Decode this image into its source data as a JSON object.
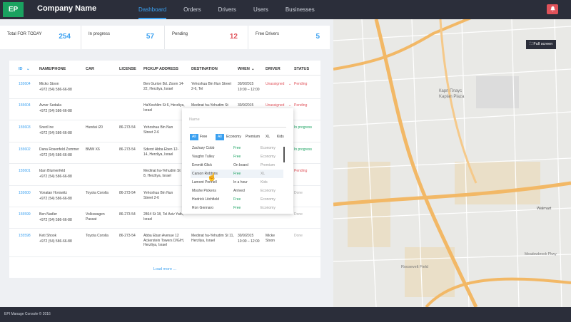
{
  "header": {
    "logo": "EP",
    "company": "Company Name",
    "nav": [
      "Dashboard",
      "Orders",
      "Drivers",
      "Users",
      "Businesses"
    ],
    "notification_icon": "bell-icon"
  },
  "stats": [
    {
      "label": "Total FOR TODAY",
      "value": "254",
      "color": "#3aa0f0"
    },
    {
      "label": "In progress",
      "value": "57",
      "color": "#3aa0f0"
    },
    {
      "label": "Pending",
      "value": "12",
      "color": "#e0525a"
    },
    {
      "label": "Free Drivers",
      "value": "5",
      "color": "#3aa0f0"
    }
  ],
  "table": {
    "headers": [
      "ID",
      "NAME/PHONE",
      "CAR",
      "LICENSE",
      "PICKUP ADDRESS",
      "DESTINATION",
      "WHEN",
      "DRIVER",
      "STATUS"
    ],
    "rows": [
      {
        "id": "155604",
        "name": "Micko Stoon",
        "phone": "+972 (54) 586-66-88",
        "car": "",
        "license": "",
        "pickup": "Ben Gurion Bd. Zoom 14-22, Herzliya, Israel",
        "dest": "Yehoshua Bin Nun Street 2-6, Tel",
        "when": "30/9/2015",
        "time": "10:00 – 12:00",
        "driver": "Unassigned",
        "status": "Pending",
        "status_class": "st-red"
      },
      {
        "id": "155604",
        "name": "Avner Sedalia",
        "phone": "+972 (54) 586-66-88",
        "car": "",
        "license": "",
        "pickup": "Ha'Koshlim St 6, Herzliya, Israel",
        "dest": "Medinat ha-Yehudim St",
        "when": "30/9/2015",
        "time": "",
        "driver": "Unassigned",
        "status": "Pending",
        "status_class": "st-red"
      },
      {
        "id": "155603",
        "name": "Sned Ine",
        "phone": "+972 (54) 586-66-88",
        "car": "Hundai i20",
        "license": "86-273-54",
        "pickup": "Yehoshua Bin Nun Street 2-6",
        "dest": "",
        "when": "",
        "time": "",
        "driver": "",
        "status": "In progress",
        "status_class": "st-green"
      },
      {
        "id": "155602",
        "name": "Dana Rosenfeld Zommer",
        "phone": "+972 (54) 586-66-88",
        "car": "BMW X6",
        "license": "86-273-54",
        "pickup": "Sderot Abba Eben 12-14, Herzliya, Israel",
        "dest": "",
        "when": "",
        "time": "",
        "driver": "",
        "status": "In progress",
        "status_class": "st-green"
      },
      {
        "id": "155601",
        "name": "Idan Blumenfeld",
        "phone": "+972 (54) 586-66-88",
        "car": "",
        "license": "",
        "pickup": "Medinat ha-Yehudim St 8, Herzliya, Israel",
        "dest": "",
        "when": "",
        "time": "",
        "driver": "",
        "status": "Pending",
        "status_class": "st-red"
      },
      {
        "id": "155600",
        "name": "Yonatan Horowitz",
        "phone": "+972 (54) 586-66-88",
        "car": "Toyota Corolla",
        "license": "86-273-54",
        "pickup": "Yehoshua Bin Nun Street 2-6",
        "dest": "",
        "when": "",
        "time": "",
        "driver": "",
        "status": "Done",
        "status_class": "st-gray"
      },
      {
        "id": "155599",
        "name": "Ben Nadler",
        "phone": "+972 (54) 586-66-88",
        "car": "Volkswagen Passat",
        "license": "86-273-54",
        "pickup": "2864 St 18, Tel Aviv Yafo, Israel",
        "dest": "",
        "when": "",
        "time": "",
        "driver": "",
        "status": "Done",
        "status_class": "st-gray"
      },
      {
        "id": "155598",
        "name": "Keti Shook",
        "phone": "+972 (54) 586-66-88",
        "car": "Toyota Corolla",
        "license": "86-273-54",
        "pickup": "Abba Eban Avenue 12 Ackerstein Towers D/G/H, Herzliya, Israel",
        "dest": "Medinat ha-Yehudim St 11, Herzliya, Israel",
        "when": "30/9/2015",
        "time": "10:00 – 12:00",
        "driver": "Micke Stoon",
        "status": "Done",
        "status_class": "st-gray"
      }
    ],
    "load_more": "Load more ..."
  },
  "popup": {
    "search_placeholder": "Name",
    "filters": [
      "All",
      "Free",
      "All",
      "Economy",
      "Premium",
      "XL",
      "Kids"
    ],
    "drivers": [
      {
        "name": "Zachary Cobb",
        "state": "Free",
        "cls": "st-green",
        "type": "Economy"
      },
      {
        "name": "Vaughn Tulley",
        "state": "Free",
        "cls": "st-green",
        "type": "Economy"
      },
      {
        "name": "Emmitt Glick",
        "state": "On board",
        "cls": "",
        "type": "Premium"
      },
      {
        "name": "Carson Robbins",
        "state": "Free",
        "cls": "st-green",
        "type": "XL"
      },
      {
        "name": "Lamont Pennell",
        "state": "In a hour",
        "cls": "",
        "type": "Kids"
      },
      {
        "name": "Moshe Pickens",
        "state": "Arrived",
        "cls": "",
        "type": "Economy"
      },
      {
        "name": "Hedrick Litchfield",
        "state": "Free",
        "cls": "st-green",
        "type": "Economy"
      },
      {
        "name": "Ron Gennaro",
        "state": "Free",
        "cls": "st-green",
        "type": "Economy"
      }
    ]
  },
  "map": {
    "full_screen": "Full screen",
    "labels": [
      "Карп Плаус",
      "Kaplan Plaza",
      "Walmart",
      "Roosevelt Field",
      "Meadowbrook Pkwy"
    ]
  },
  "footer": "EPI Manage Console © 2016"
}
